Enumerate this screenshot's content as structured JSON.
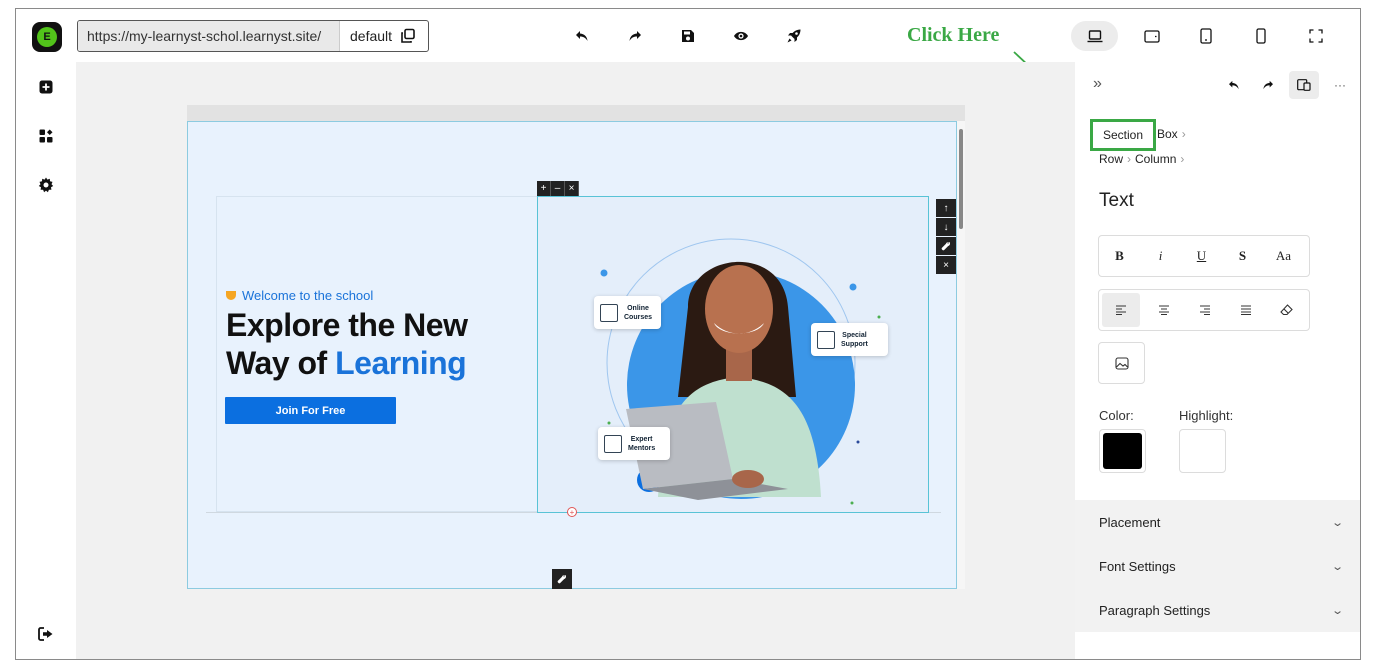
{
  "url_bar": {
    "url": "https://my-learnyst-schol.learnyst.site/",
    "theme": "default"
  },
  "toolbar": {
    "icons": [
      "undo-icon",
      "redo-icon",
      "save-icon",
      "preview-eye-icon",
      "publish-rocket-icon"
    ]
  },
  "annotation": {
    "text": "Click Here",
    "color": "#3aa845"
  },
  "devices": [
    "desktop-icon",
    "tablet-landscape-icon",
    "tablet-portrait-icon",
    "mobile-icon",
    "fullscreen-icon"
  ],
  "left_sidebar": {
    "icons": [
      "add-block-icon",
      "widgets-icon",
      "settings-gear-icon",
      "logout-icon"
    ]
  },
  "hero": {
    "welcome": "Welcome to the school",
    "headline_line1": "Explore the New",
    "headline_line2_prefix": "Way of ",
    "headline_line2_highlight": "Learning",
    "cta": "Join For Free",
    "cards": {
      "online_courses_1": "Online",
      "online_courses_2": "Courses",
      "special_support_1": "Special",
      "special_support_2": "Support",
      "expert_mentors_1": "Expert",
      "expert_mentors_2": "Mentors"
    },
    "accent_color": "#1a73d9"
  },
  "editor_controls": {
    "plus": "+",
    "minus": "–",
    "close": "×"
  },
  "right_panel": {
    "breadcrumb": {
      "section": "Section",
      "box": "Box",
      "row": "Row",
      "column": "Column"
    },
    "title": "Text",
    "format_buttons": [
      "B",
      "i",
      "U",
      "S",
      "Aa"
    ],
    "align_buttons": [
      "align-left-icon",
      "align-center-icon",
      "align-right-icon",
      "align-justify-icon",
      "clear-format-eraser-icon"
    ],
    "image_button": "image-icon",
    "color_label": "Color:",
    "highlight_label": "Highlight:",
    "color_value": "#000000",
    "highlight_value": "#ffffff",
    "accordions": {
      "placement": "Placement",
      "font_settings": "Font Settings",
      "paragraph_settings": "Paragraph Settings"
    }
  }
}
